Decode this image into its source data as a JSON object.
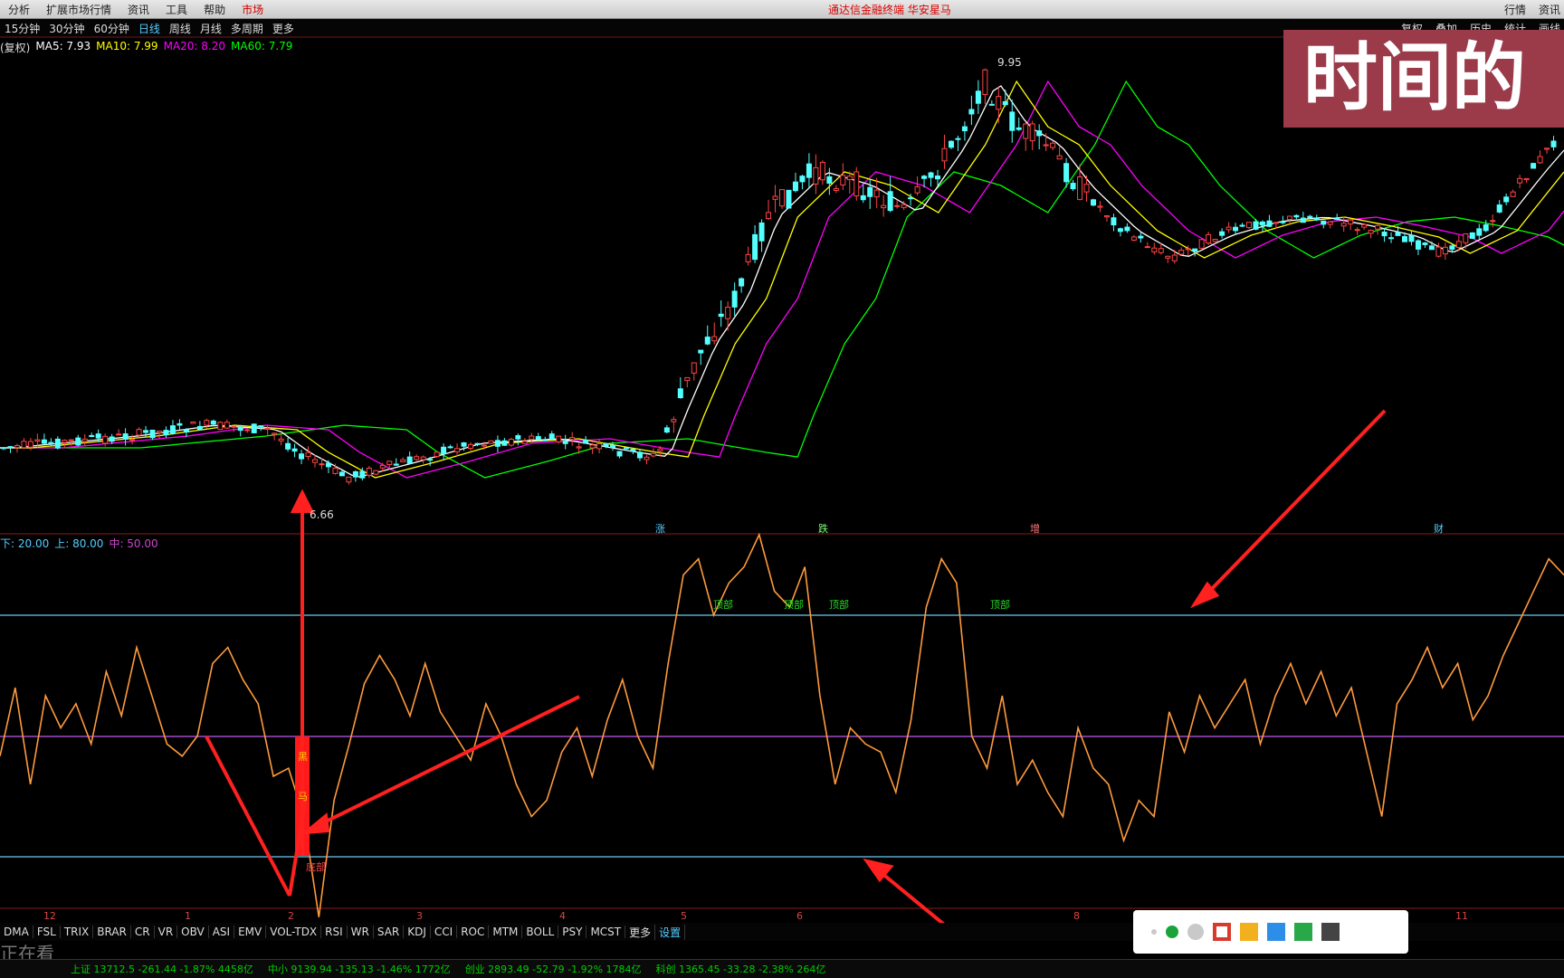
{
  "menu": {
    "items": [
      "分析",
      "扩展市场行情",
      "资讯",
      "工具",
      "帮助",
      "市场"
    ],
    "center_title": "通达信金融终端 华安星马",
    "right_items": [
      "行情",
      "资讯"
    ]
  },
  "periods": {
    "items": [
      "15分钟",
      "30分钟",
      "60分钟",
      "日线",
      "周线",
      "月线",
      "多周期",
      "更多"
    ],
    "right_items": [
      "复权",
      "叠加",
      "历史",
      "统计",
      "画线"
    ]
  },
  "ma_legend": {
    "prefix": "(复权)",
    "ma5": "MA5: 7.93",
    "ma10": "MA10: 7.99",
    "ma20": "MA20: 8.20",
    "ma60": "MA60: 7.79",
    "colors": {
      "ma5": "#ffffff",
      "ma10": "#ffff00",
      "ma20": "#ff00ff",
      "ma60": "#00ff00"
    }
  },
  "indicator_legend": {
    "low": "下: 20.00",
    "high": "上: 80.00",
    "mid": "中: 50.00"
  },
  "price_labels": {
    "high": "9.95",
    "low": "6.66"
  },
  "overlay_text": "时间的",
  "signals_top": [
    "涨",
    "跌",
    "增",
    "财"
  ],
  "signals_line": [
    "顶部",
    "顶部",
    "顶部",
    "顶部"
  ],
  "bottom_signal": "底部",
  "red_bar_text": [
    "黑",
    "马"
  ],
  "x_axis_labels": [
    "12",
    "1",
    "2",
    "3",
    "4",
    "5",
    "6",
    "8",
    "11"
  ],
  "indicator_tabs": [
    "DMA",
    "FSL",
    "TRIX",
    "BRAR",
    "CR",
    "VR",
    "OBV",
    "ASI",
    "EMV",
    "VOL-TDX",
    "RSI",
    "WR",
    "SAR",
    "KDJ",
    "CCI",
    "ROC",
    "MTM",
    "BOLL",
    "PSY",
    "MCST",
    "更多",
    "设置"
  ],
  "status": {
    "s1": "上证 13712.5 -261.44 -1.87% 4458亿",
    "s2": "中小 9139.94 -135.13 -1.46% 1772亿",
    "s3": "创业 2893.49 -52.79 -1.92% 1784亿",
    "s4": "科创 1365.45 -33.28 -2.38% 264亿"
  },
  "watching_text": "正在看",
  "toolbar_colors": [
    "#c9c9c9",
    "#1aa33a",
    "#c9c9c9",
    "#d83a2e",
    "#f2b01e",
    "#2d8ee8",
    "#29a84a",
    "#444444"
  ],
  "chart_data": {
    "type": "line",
    "title": "",
    "price_series_note": "candlestick",
    "indicator_levels": [
      20,
      50,
      80
    ],
    "indicator_values": [
      45,
      62,
      38,
      60,
      52,
      58,
      48,
      66,
      55,
      72,
      60,
      48,
      45,
      50,
      68,
      72,
      64,
      58,
      40,
      42,
      30,
      5,
      34,
      48,
      63,
      70,
      64,
      55,
      68,
      56,
      50,
      44,
      58,
      50,
      38,
      30,
      34,
      46,
      52,
      40,
      54,
      64,
      50,
      42,
      68,
      90,
      94,
      80,
      88,
      92,
      100,
      86,
      82,
      92,
      60,
      38,
      52,
      48,
      46,
      36,
      54,
      82,
      94,
      88,
      50,
      42,
      60,
      38,
      44,
      36,
      30,
      52,
      42,
      38,
      24,
      34,
      30,
      56,
      46,
      60,
      52,
      58,
      64,
      48,
      60,
      68,
      58,
      66,
      55,
      62,
      46,
      30,
      58,
      64,
      72,
      62,
      68,
      54,
      60,
      70,
      78,
      86,
      94,
      90
    ]
  }
}
